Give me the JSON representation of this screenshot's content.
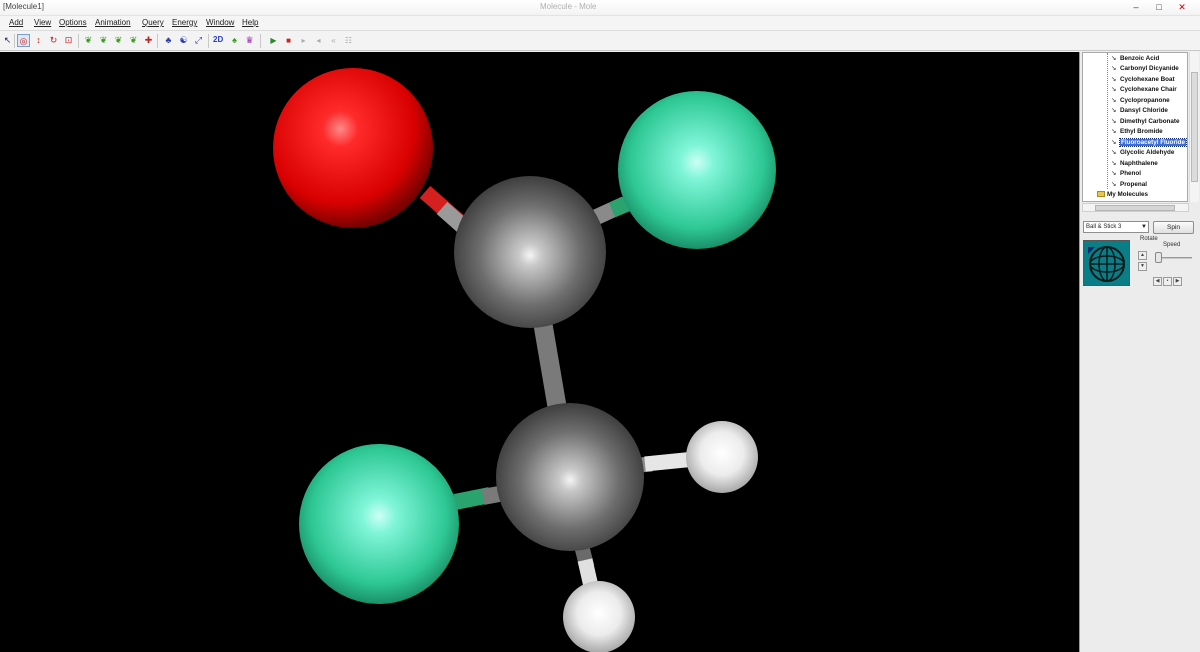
{
  "window": {
    "app_title": "[Molecule1]",
    "caption": "Molecule - Mole",
    "controls": {
      "minimize": "–",
      "maximize": "□",
      "close": "✕"
    }
  },
  "menu": [
    "Add",
    "View",
    "Options",
    "Animation",
    "Query",
    "Energy",
    "Window",
    "Help"
  ],
  "toolbar": {
    "label_2d": "2D"
  },
  "viewport": {
    "background": "#000000",
    "atoms": [
      {
        "element": "O",
        "color": "#e81818"
      },
      {
        "element": "F",
        "color": "#3fe0a8"
      },
      {
        "element": "C",
        "color": "#7a7a7a"
      },
      {
        "element": "C",
        "color": "#7a7a7a"
      },
      {
        "element": "F",
        "color": "#3fe0a8"
      },
      {
        "element": "H",
        "color": "#f0f0f0"
      },
      {
        "element": "H",
        "color": "#f0f0f0"
      }
    ]
  },
  "molecule_tree": {
    "items": [
      "Benzoic Acid",
      "Carbonyl Dicyanide",
      "Cyclohexane Boat",
      "Cyclohexane Chair",
      "Cyclopropanone",
      "Dansyl Chloride",
      "Dimethyl Carbonate",
      "Ethyl Bromide",
      "Fluoroacetyl Fluoride",
      "Glycolic Aldehyde",
      "Naphthalene",
      "Phenol",
      "Propenal"
    ],
    "selected": "Fluoroacetyl Fluoride",
    "folder": "My Molecules"
  },
  "display_panel": {
    "style_select": "Ball & Stick 3",
    "spin_button": "Spin",
    "rotate_label": "Rotate",
    "speed_label": "Speed"
  }
}
